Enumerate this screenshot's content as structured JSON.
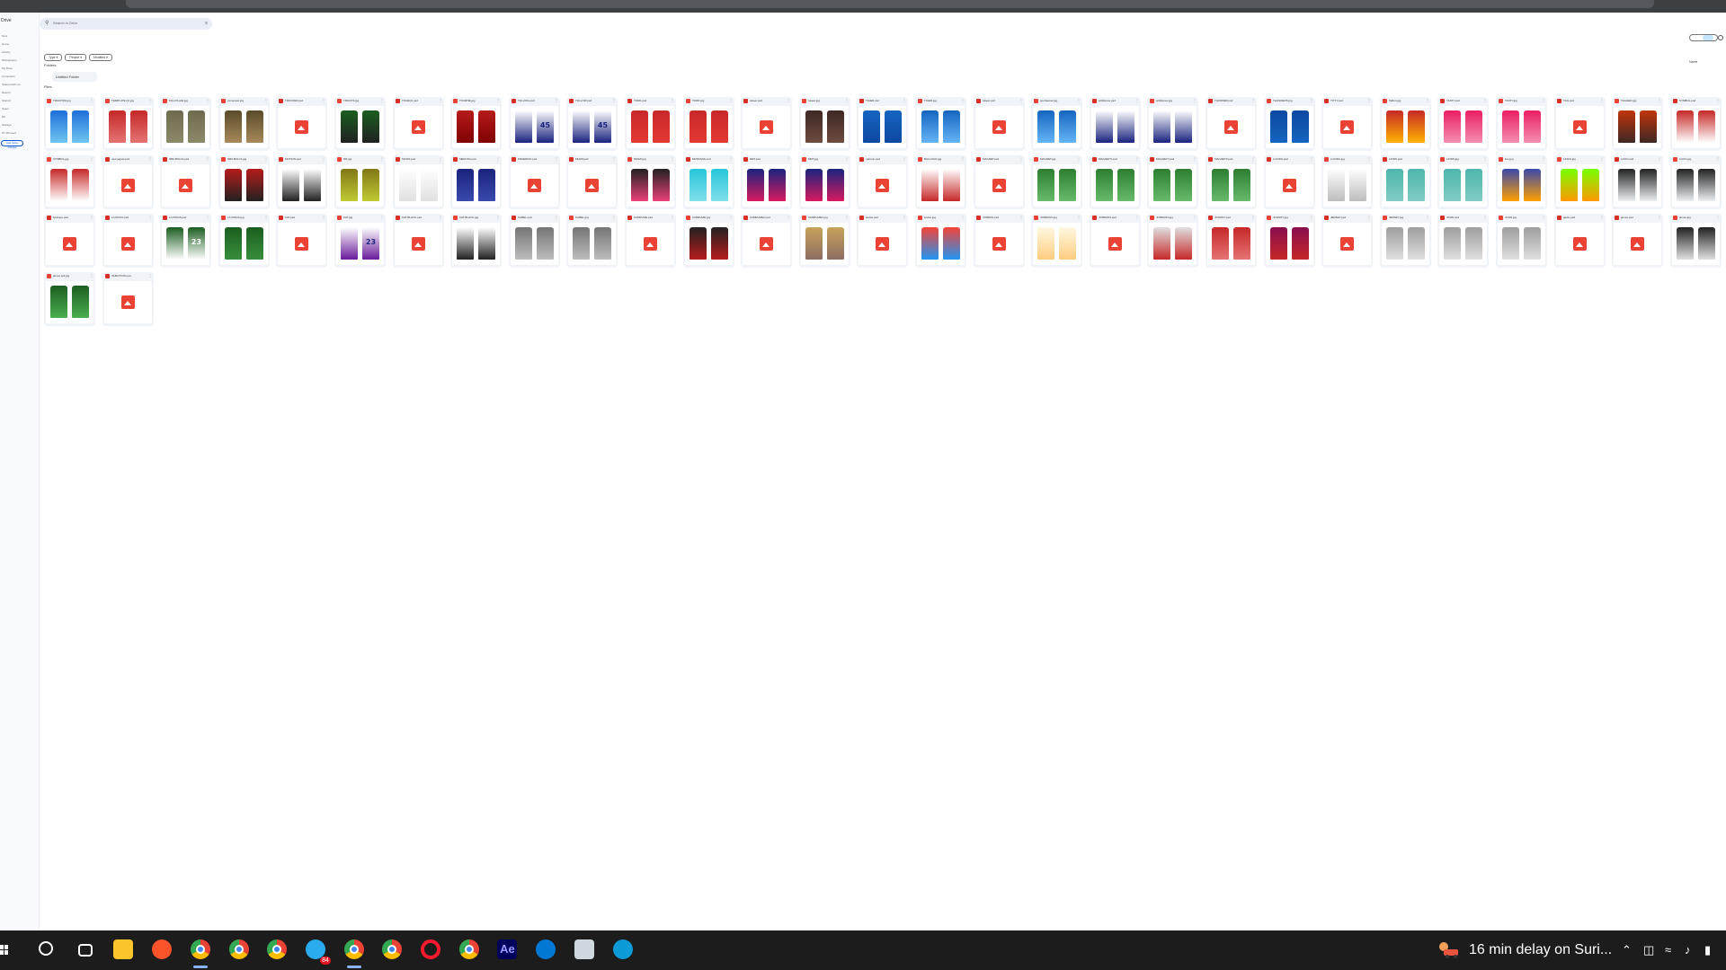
{
  "drive": {
    "brand": "Drive",
    "nav_items": [
      "New",
      "Home",
      "Activity",
      "Workspaces",
      "My Drive",
      "Computers",
      "Shared with me",
      "Recent",
      "Starred",
      "Spam",
      "Bin",
      "Storage"
    ],
    "storage_text": "87 GB used",
    "storage_button": "Get more storage",
    "search_placeholder": "Search in Drive",
    "filters": [
      "Type",
      "People",
      "Modified"
    ],
    "folders_label": "Folders",
    "folder_name": "Untitled Folder",
    "files_label": "Files",
    "sort_label": "Name",
    "files": [
      {
        "name": "TRICOT(9).jpg",
        "kind": "img",
        "colors": [
          "#1e6fd9",
          "#6fc6f0"
        ]
      },
      {
        "name": "TEMPLATE (2).jpg",
        "kind": "img",
        "colors": [
          "#c62828",
          "#e57373"
        ]
      },
      {
        "name": "FILLOS.ahd.jpg",
        "kind": "img",
        "colors": [
          "#6d6a4f",
          "#8d8a6a"
        ]
      },
      {
        "name": "yemeneto.jpg",
        "kind": "img",
        "colors": [
          "#5a4a2a",
          "#a88a5a"
        ]
      },
      {
        "name": "TRUCKER.psd",
        "kind": "ph"
      },
      {
        "name": "TRUCKS.jpg",
        "kind": "img",
        "colors": [
          "#1b5e20",
          "#212121"
        ]
      },
      {
        "name": "TOUR(2).psd",
        "kind": "ph"
      },
      {
        "name": "TOURNE.jpg",
        "kind": "img",
        "colors": [
          "#b71c1c",
          "#7f0000"
        ]
      },
      {
        "name": "TOLLING.psd",
        "kind": "img",
        "colors": [
          "#ffffff",
          "#1a237e"
        ],
        "num": "45"
      },
      {
        "name": "TOLLOW.psd",
        "kind": "img",
        "colors": [
          "#ffffff",
          "#1a237e"
        ],
        "num": "45"
      },
      {
        "name": "TODD.psd",
        "kind": "img",
        "colors": [
          "#c62828",
          "#e53935"
        ]
      },
      {
        "name": "TODD.jpg",
        "kind": "img",
        "colors": [
          "#c62828",
          "#e53935"
        ]
      },
      {
        "name": "tekeet.psd",
        "kind": "ph"
      },
      {
        "name": "tekeet.jpg",
        "kind": "img",
        "colors": [
          "#3e2723",
          "#6d4c41"
        ]
      },
      {
        "name": "TIGER.psd",
        "kind": "img",
        "colors": [
          "#1565c0",
          "#0d47a1"
        ]
      },
      {
        "name": "TIGER.jpg",
        "kind": "img",
        "colors": [
          "#1565c0",
          "#64b5f6"
        ]
      },
      {
        "name": "tekeet.psd",
        "kind": "ph"
      },
      {
        "name": "sportswear.jpg",
        "kind": "img",
        "colors": [
          "#1565c0",
          "#64b5f6"
        ]
      },
      {
        "name": "phillipines.psd",
        "kind": "img",
        "colors": [
          "#ffffff",
          "#1a237e"
        ]
      },
      {
        "name": "phillipines.jpg",
        "kind": "img",
        "colors": [
          "#ffffff",
          "#1a237e"
        ]
      },
      {
        "name": "THUNDER.psd",
        "kind": "ph"
      },
      {
        "name": "THUNDERS.jpg",
        "kind": "img",
        "colors": [
          "#0d47a1",
          "#1565c0"
        ]
      },
      {
        "name": "TITTY.psd",
        "kind": "ph"
      },
      {
        "name": "Tallinn.jpg",
        "kind": "img",
        "colors": [
          "#c62828",
          "#ffb300"
        ]
      },
      {
        "name": "TASTY.psd",
        "kind": "img",
        "colors": [
          "#e91e63",
          "#f48fb1"
        ]
      },
      {
        "name": "TASTY.jpg",
        "kind": "img",
        "colors": [
          "#e91e63",
          "#f48fb1"
        ]
      },
      {
        "name": "TAG.psd",
        "kind": "ph"
      },
      {
        "name": "TAGGED.jpg",
        "kind": "img",
        "colors": [
          "#bf360c",
          "#3e2723"
        ]
      },
      {
        "name": "SYMBOL.psd",
        "kind": "img",
        "colors": [
          "#c62828",
          "#ffffff"
        ]
      },
      {
        "name": "SYMBOL.jpg",
        "kind": "img",
        "colors": [
          "#c62828",
          "#ffffff"
        ]
      },
      {
        "name": "new jaguar.psd",
        "kind": "ph"
      },
      {
        "name": "NBA BULLS.psd",
        "kind": "ph"
      },
      {
        "name": "NBA BULLS.jpg",
        "kind": "img",
        "colors": [
          "#b71c1c",
          "#212121"
        ]
      },
      {
        "name": "MOTION.psd",
        "kind": "img",
        "colors": [
          "#ffffff",
          "#212121"
        ]
      },
      {
        "name": "NR.jpg",
        "kind": "img",
        "colors": [
          "#827717",
          "#c0ca33"
        ]
      },
      {
        "name": "MOON.psd",
        "kind": "img",
        "colors": [
          "#ffffff",
          "#e0e0e0"
        ]
      },
      {
        "name": "MEDUSA.psd",
        "kind": "img",
        "colors": [
          "#1a237e",
          "#3949ab"
        ]
      },
      {
        "name": "MAVERICK.psd",
        "kind": "ph"
      },
      {
        "name": "MIAMI.psd",
        "kind": "ph"
      },
      {
        "name": "MIAMI.jpg",
        "kind": "img",
        "colors": [
          "#212121",
          "#ec407a"
        ]
      },
      {
        "name": "MONTANA.psd",
        "kind": "img",
        "colors": [
          "#26c6da",
          "#80deea"
        ]
      },
      {
        "name": "MDT.psd",
        "kind": "img",
        "colors": [
          "#1a237e",
          "#d81b60"
        ]
      },
      {
        "name": "MDT.jpg",
        "kind": "img",
        "colors": [
          "#1a237e",
          "#d81b60"
        ]
      },
      {
        "name": "maroon.psd",
        "kind": "ph"
      },
      {
        "name": "BALLOGO.jpg",
        "kind": "img",
        "colors": [
          "#ffffff",
          "#c62828"
        ]
      },
      {
        "name": "MAGNET.psd",
        "kind": "ph"
      },
      {
        "name": "MAGNET.jpg",
        "kind": "img",
        "colors": [
          "#2e7d32",
          "#66bb6a"
        ]
      },
      {
        "name": "MAGNETX.psd",
        "kind": "img",
        "colors": [
          "#2e7d32",
          "#66bb6a"
        ]
      },
      {
        "name": "MAGNETY.psd",
        "kind": "img",
        "colors": [
          "#2e7d32",
          "#66bb6a"
        ]
      },
      {
        "name": "MAGNETZ.psd",
        "kind": "img",
        "colors": [
          "#2e7d32",
          "#66bb6a"
        ]
      },
      {
        "name": "LUCIDA.psd",
        "kind": "ph"
      },
      {
        "name": "LUCIDA.jpg",
        "kind": "img",
        "colors": [
          "#ffffff",
          "#bdbdbd"
        ]
      },
      {
        "name": "LIONS.psd",
        "kind": "img",
        "colors": [
          "#4db6ac",
          "#80cbc4"
        ]
      },
      {
        "name": "LIONS.jpg",
        "kind": "img",
        "colors": [
          "#4db6ac",
          "#80cbc4"
        ]
      },
      {
        "name": "lion.jpg",
        "kind": "img",
        "colors": [
          "#3949ab",
          "#ffa000"
        ]
      },
      {
        "name": "LINGS.jpg",
        "kind": "img",
        "colors": [
          "#76ff03",
          "#ff9800"
        ]
      },
      {
        "name": "LOCO.psd",
        "kind": "img",
        "colors": [
          "#212121",
          "#eceff1"
        ]
      },
      {
        "name": "LOCO.jpg",
        "kind": "img",
        "colors": [
          "#212121",
          "#eceff1"
        ]
      },
      {
        "name": "lipstique.psd",
        "kind": "ph"
      },
      {
        "name": "LA ROCO.psd",
        "kind": "ph"
      },
      {
        "name": "LA KINGS.psd",
        "kind": "img",
        "colors": [
          "#1b5e20",
          "#ffffff"
        ],
        "num": "23"
      },
      {
        "name": "LA KINGS.jpg",
        "kind": "img",
        "colors": [
          "#1b5e20",
          "#388e3c"
        ]
      },
      {
        "name": "KAT.psd",
        "kind": "ph"
      },
      {
        "name": "KAT.jpg",
        "kind": "img",
        "colors": [
          "#ffffff",
          "#6a1b9a"
        ],
        "num": "23"
      },
      {
        "name": "KAT BLACK.psd",
        "kind": "ph"
      },
      {
        "name": "KAT BLACK.jpg",
        "kind": "img",
        "colors": [
          "#ffffff",
          "#212121"
        ]
      },
      {
        "name": "KAREL.psd",
        "kind": "img",
        "colors": [
          "#757575",
          "#bdbdbd"
        ]
      },
      {
        "name": "KAREL.jpg",
        "kind": "img",
        "colors": [
          "#757575",
          "#bdbdbd"
        ]
      },
      {
        "name": "KAMIKAZE.psd",
        "kind": "ph"
      },
      {
        "name": "KAMIKAZE.jpg",
        "kind": "img",
        "colors": [
          "#212121",
          "#b71c1c"
        ]
      },
      {
        "name": "KAMIKAZE2.psd",
        "kind": "ph"
      },
      {
        "name": "KAMIKAZE2.jpg",
        "kind": "img",
        "colors": [
          "#c8a35a",
          "#8d6e63"
        ]
      },
      {
        "name": "kodoo.psd",
        "kind": "ph"
      },
      {
        "name": "kodoo.jpg",
        "kind": "img",
        "colors": [
          "#f44336",
          "#2196f3"
        ]
      },
      {
        "name": "JORDAN.psd",
        "kind": "ph"
      },
      {
        "name": "JORDAN2.jpg",
        "kind": "img",
        "colors": [
          "#fff8e1",
          "#ffcc80"
        ]
      },
      {
        "name": "JORDAN3.psd",
        "kind": "ph"
      },
      {
        "name": "JORDAN3.jpg",
        "kind": "img",
        "colors": [
          "#e0e0e0",
          "#c62828"
        ]
      },
      {
        "name": "JOHNNY.psd",
        "kind": "img",
        "colors": [
          "#c62828",
          "#e57373"
        ]
      },
      {
        "name": "JOHNNY.jpg",
        "kind": "img",
        "colors": [
          "#880e4f",
          "#c62828"
        ]
      },
      {
        "name": "JERSEY.psd",
        "kind": "ph"
      },
      {
        "name": "JERSEY.jpg",
        "kind": "img",
        "colors": [
          "#9e9e9e",
          "#e0e0e0"
        ]
      },
      {
        "name": "JOHN.psd",
        "kind": "img",
        "colors": [
          "#9e9e9e",
          "#e0e0e0"
        ]
      },
      {
        "name": "JOHN.jpg",
        "kind": "img",
        "colors": [
          "#9e9e9e",
          "#e0e0e0"
        ]
      },
      {
        "name": "japan.psd",
        "kind": "ph"
      },
      {
        "name": "james.psd",
        "kind": "ph"
      },
      {
        "name": "james.jpg",
        "kind": "img",
        "colors": [
          "#212121",
          "#e0e0e0"
        ]
      },
      {
        "name": "james sell.jpg",
        "kind": "img",
        "colors": [
          "#1b5e20",
          "#4caf50"
        ]
      },
      {
        "name": "INJECTION.psd",
        "kind": "ph"
      }
    ]
  },
  "taskbar": {
    "apps": [
      {
        "name": "search",
        "color": "#ffffff"
      },
      {
        "name": "task-view",
        "color": "#ffffff"
      },
      {
        "name": "file-explorer",
        "color": "#f9c52a"
      },
      {
        "name": "brave",
        "color": "#fb542b"
      },
      {
        "name": "chrome-m",
        "color": "#34a853"
      },
      {
        "name": "chrome-f",
        "color": "#fbbc05"
      },
      {
        "name": "chrome-c",
        "color": "#4285f4"
      },
      {
        "name": "telegram",
        "color": "#2aabee",
        "badge": "84"
      },
      {
        "name": "chrome-m2",
        "color": "#ea4335"
      },
      {
        "name": "chrome",
        "color": "#4285f4"
      },
      {
        "name": "opera",
        "color": "#ff1b2d"
      },
      {
        "name": "chrome-k",
        "color": "#34a853"
      },
      {
        "name": "after-effects",
        "color": "#9999ff",
        "label": "Ae"
      },
      {
        "name": "vscode",
        "color": "#0078d4"
      },
      {
        "name": "notes",
        "color": "#cfd8dc"
      },
      {
        "name": "edge",
        "color": "#0c9bd7"
      }
    ],
    "weather_text": "16 min delay on Suri...",
    "colors": {
      "bg": "#1c1c1c",
      "accent": "#8ab4f8"
    }
  }
}
